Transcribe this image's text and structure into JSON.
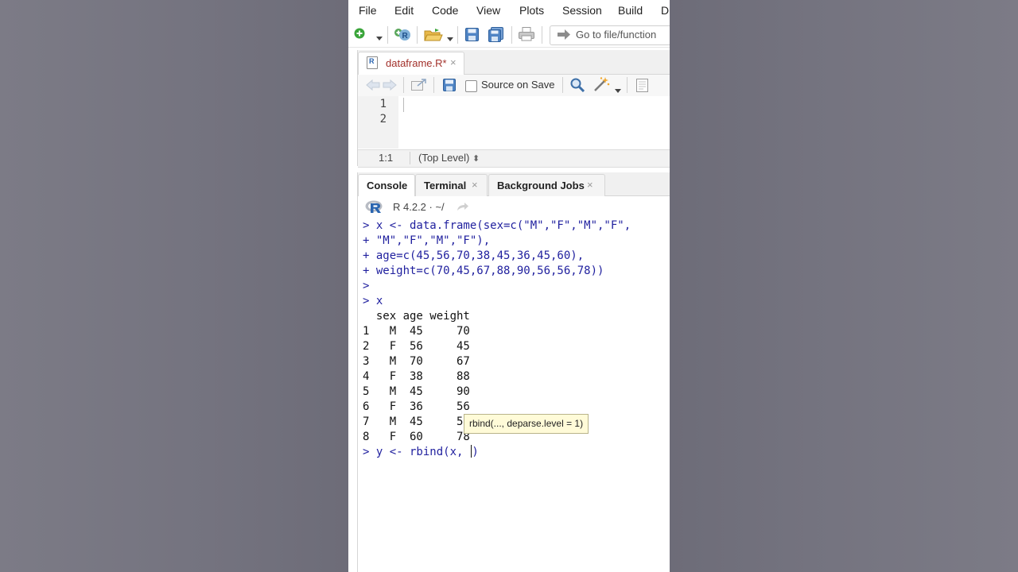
{
  "menu": [
    "File",
    "Edit",
    "Code",
    "View",
    "Plots",
    "Session",
    "Build",
    "D"
  ],
  "toolbar": {
    "goto_placeholder": "Go to file/function",
    "icons": [
      "new-file-icon",
      "dropdown-icon",
      "new-project-icon",
      "open-folder-icon",
      "save-icon",
      "save-all-icon",
      "print-icon",
      "go-to-arrow-icon"
    ]
  },
  "source": {
    "tab_label": "dataframe.R*",
    "tab_close": "×",
    "file_badge": "R",
    "source_on_save": "Source on Save",
    "line_numbers": [
      "1",
      "2"
    ],
    "cursor_position": "1:1",
    "scope": "(Top Level)",
    "scope_arrows": "⬍"
  },
  "console": {
    "tabs": [
      {
        "label": "Console",
        "active": true
      },
      {
        "label": "Terminal",
        "close": "×"
      },
      {
        "label": "Background Jobs",
        "close": "×"
      }
    ],
    "r_version": "R 4.2.2 · ~/",
    "lines": [
      {
        "text": "> x <- data.frame(sex=c(\"M\",\"F\",\"M\",\"F\",",
        "kind": "in"
      },
      {
        "text": "+ \"M\",\"F\",\"M\",\"F\"),",
        "kind": "in"
      },
      {
        "text": "+ age=c(45,56,70,38,45,36,45,60),",
        "kind": "in"
      },
      {
        "text": "+ weight=c(70,45,67,88,90,56,56,78))",
        "kind": "in"
      },
      {
        "text": ">",
        "kind": "in"
      },
      {
        "text": "> x",
        "kind": "in"
      },
      {
        "text": "  sex age weight",
        "kind": "out"
      },
      {
        "text": "1   M  45     70",
        "kind": "out"
      },
      {
        "text": "2   F  56     45",
        "kind": "out"
      },
      {
        "text": "3   M  70     67",
        "kind": "out"
      },
      {
        "text": "4   F  38     88",
        "kind": "out"
      },
      {
        "text": "5   M  45     90",
        "kind": "out"
      },
      {
        "text": "6   F  36     56",
        "kind": "out"
      },
      {
        "text": "7   M  45     56",
        "kind": "out"
      },
      {
        "text": "8   F  60     78",
        "kind": "out"
      }
    ],
    "current_input": "> y <- rbind(x, ",
    "current_input_close": ")",
    "tooltip": "rbind(..., deparse.level = 1)"
  },
  "colors": {
    "console_input": "#1f1f9e",
    "tab_modified": "#a2302a",
    "tooltip_bg": "#fffbd8"
  }
}
